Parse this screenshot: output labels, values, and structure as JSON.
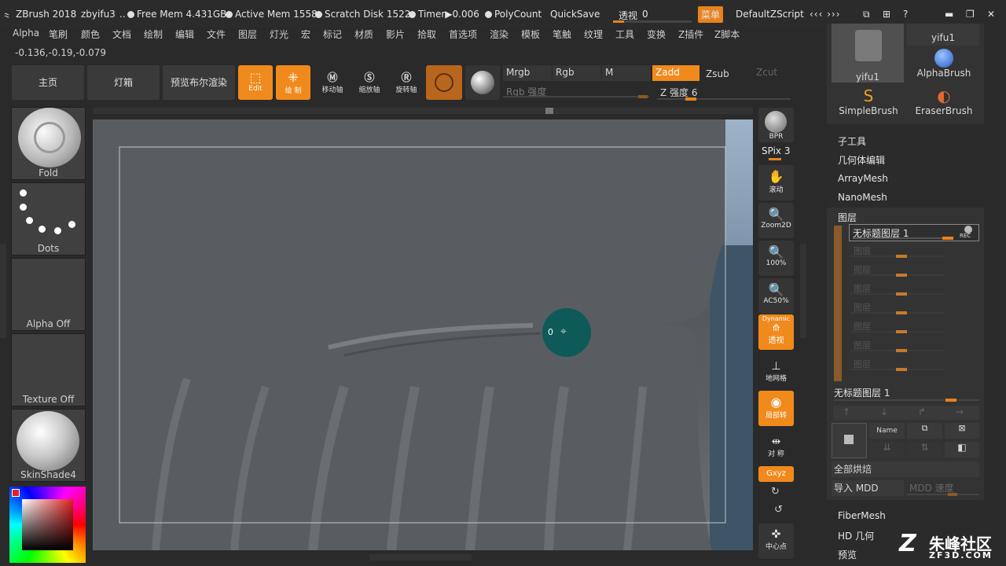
{
  "title_bar": {
    "app": "ZBrush 2018",
    "user": "zbyifu3",
    "free_mem": "Free Mem 4.431GB",
    "active_mem": "Active Mem 1558",
    "scratch_disk": "Scratch Disk 1522",
    "timer": "Timer▶0.006",
    "polycount": "PolyCount",
    "quicksave": "QuickSave",
    "transparency_label": "透视",
    "transparency_value": "0",
    "menu_button": "菜单",
    "script": "DefaultZScript"
  },
  "menu": [
    "Alpha",
    "笔刷",
    "颜色",
    "文档",
    "绘制",
    "编辑",
    "文件",
    "图层",
    "灯光",
    "宏",
    "标记",
    "材质",
    "影片",
    "拾取",
    "首选项",
    "渲染",
    "模板",
    "笔触",
    "纹理",
    "工具",
    "变换",
    "Z插件",
    "Z脚本"
  ],
  "coords": "-0.136,-0.19,-0.079",
  "toolbar": {
    "home": "主页",
    "lightbox": "灯箱",
    "bpr_preview": "预览布尔渲染",
    "edit": "Edit",
    "draw": "绘 制",
    "move": "移动轴",
    "scale": "缩放轴",
    "rotate": "旋转轴",
    "mrgb": "Mrgb",
    "rgb": "Rgb",
    "m": "M",
    "zadd": "Zadd",
    "zsub": "Zsub",
    "zcut": "Zcut",
    "rgb_intensity": "Rgb 强度",
    "z_intensity_label": "Z 强度",
    "z_intensity_value": "6"
  },
  "left_tray": {
    "brush": "Fold",
    "stroke": "Dots",
    "alpha": "Alpha Off",
    "texture": "Texture Off",
    "material": "SkinShade4"
  },
  "canvas": {
    "brush_cursor_value": "0"
  },
  "right_shelf": {
    "bpr": "BPR",
    "spix": "SPix 3",
    "scroll": "滚动",
    "zoom2d": "Zoom2D",
    "zoom100": "100%",
    "ac50": "AC50%",
    "dynamic": "Dynamic",
    "perspective": "透视",
    "floor": "地网格",
    "local": "局部转",
    "symmetry": "对 称",
    "xyz": "Gxyz",
    "center": "中心点"
  },
  "right_panel": {
    "tool_thumb": "yifu1",
    "tool_current": "yifu1",
    "alpha_brush": "AlphaBrush",
    "simple_brush": "SimpleBrush",
    "eraser_brush": "EraserBrush",
    "subtool": "子工具",
    "geometry": "几何体编辑",
    "arraymesh": "ArrayMesh",
    "nanomesh": "NanoMesh",
    "layers": "图层",
    "active_layer": "无标题图层 1",
    "rec": "REC",
    "layer_slot": "图层",
    "layer_name": "无标题图层 1",
    "name_btn": "Name",
    "bake_all": "全部烘焙",
    "import_mdd": "导入 MDD",
    "mdd_speed": "MDD 速度",
    "fibermesh": "FiberMesh",
    "hd_geometry": "HD 几何",
    "preview": "预览"
  },
  "watermark": {
    "name": "朱峰社区",
    "url": "ZF3D.COM"
  }
}
